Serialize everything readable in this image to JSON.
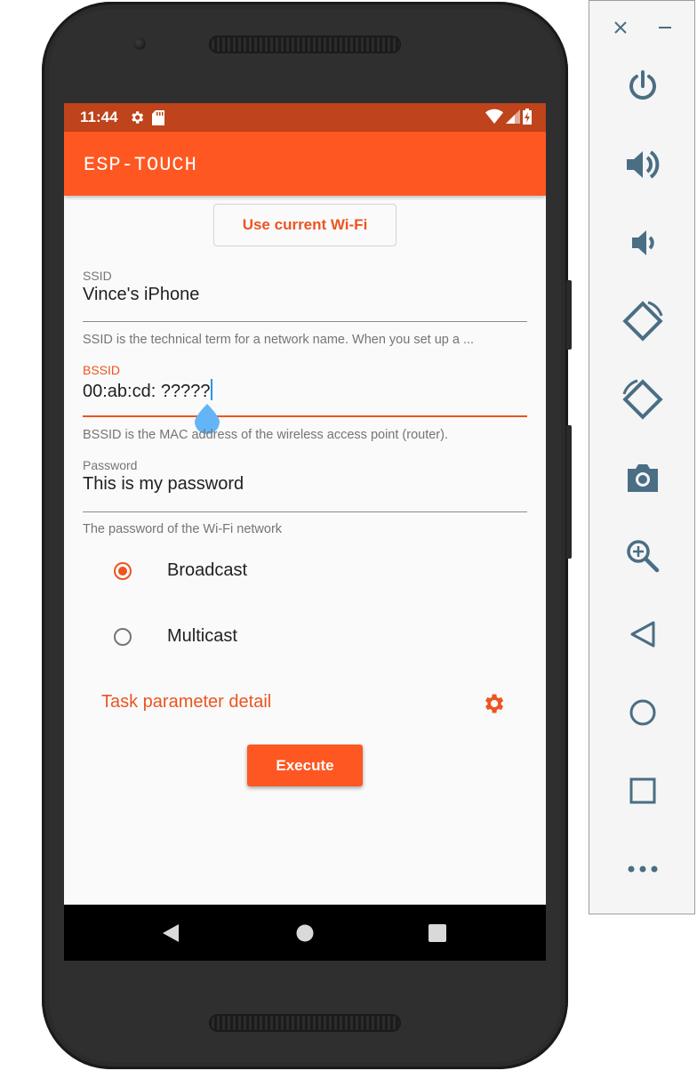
{
  "status_bar": {
    "time": "11:44",
    "background": "#bf431b"
  },
  "app_bar": {
    "title": "ESP-TOUCH",
    "background": "#fe5722"
  },
  "use_wifi_button": {
    "label": "Use current Wi-Fi"
  },
  "ssid": {
    "label": "SSID",
    "value": "Vince's iPhone",
    "helper": "SSID is the technical term for a network name. When you set up a ..."
  },
  "bssid": {
    "label": "BSSID",
    "value": "00:ab:cd: ?????",
    "helper": "BSSID is the MAC address of the wireless access point (router)."
  },
  "password": {
    "label": "Password",
    "value": "This is my password",
    "helper": "The password of the Wi-Fi network"
  },
  "mode": {
    "options": [
      "Broadcast",
      "Multicast"
    ],
    "selected": "Broadcast"
  },
  "task_link": {
    "label": "Task parameter detail",
    "icon": "gear-icon"
  },
  "execute_button": {
    "label": "Execute"
  },
  "nav_bar": {
    "icons": [
      "back-icon",
      "home-icon",
      "recents-icon"
    ]
  },
  "emulator_panel": {
    "icons": [
      "close-icon",
      "minimize-icon",
      "power-icon",
      "volume-up-icon",
      "volume-down-icon",
      "rotate-left-icon",
      "rotate-right-icon",
      "screenshot-camera-icon",
      "zoom-icon",
      "back-icon",
      "home-icon",
      "overview-icon",
      "more-icon"
    ]
  },
  "colors": {
    "accent": "#ec5521",
    "cursor": "#2196f3"
  }
}
